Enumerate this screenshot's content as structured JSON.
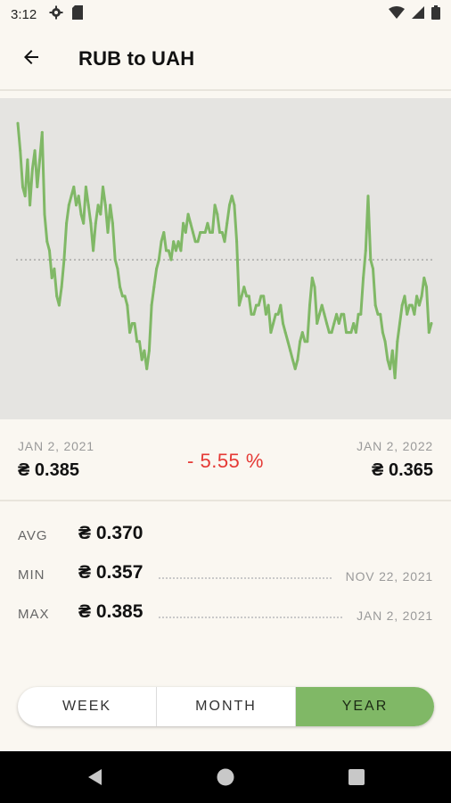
{
  "status_bar": {
    "time": "3:12"
  },
  "app_bar": {
    "title": "RUB to UAH"
  },
  "chart_data": {
    "type": "line",
    "title": "",
    "x_range": [
      "JAN 2, 2021",
      "JAN 2, 2022"
    ],
    "y_range": [
      0.355,
      0.386
    ],
    "reference_line": 0.37,
    "line_color": "#80b866",
    "grid": false,
    "values": [
      0.385,
      0.382,
      0.378,
      0.377,
      0.381,
      0.376,
      0.38,
      0.382,
      0.378,
      0.381,
      0.384,
      0.375,
      0.372,
      0.371,
      0.368,
      0.369,
      0.366,
      0.365,
      0.367,
      0.37,
      0.374,
      0.376,
      0.377,
      0.378,
      0.376,
      0.377,
      0.375,
      0.374,
      0.378,
      0.376,
      0.374,
      0.371,
      0.374,
      0.376,
      0.375,
      0.378,
      0.376,
      0.373,
      0.376,
      0.374,
      0.37,
      0.369,
      0.367,
      0.366,
      0.366,
      0.365,
      0.362,
      0.363,
      0.363,
      0.361,
      0.361,
      0.359,
      0.36,
      0.358,
      0.36,
      0.365,
      0.367,
      0.369,
      0.37,
      0.372,
      0.373,
      0.371,
      0.371,
      0.37,
      0.372,
      0.371,
      0.372,
      0.371,
      0.374,
      0.373,
      0.375,
      0.374,
      0.373,
      0.372,
      0.372,
      0.373,
      0.373,
      0.373,
      0.374,
      0.373,
      0.373,
      0.376,
      0.375,
      0.373,
      0.373,
      0.372,
      0.374,
      0.376,
      0.377,
      0.376,
      0.372,
      0.365,
      0.366,
      0.367,
      0.366,
      0.366,
      0.364,
      0.364,
      0.365,
      0.365,
      0.366,
      0.366,
      0.364,
      0.365,
      0.362,
      0.363,
      0.364,
      0.364,
      0.365,
      0.363,
      0.362,
      0.361,
      0.36,
      0.359,
      0.358,
      0.359,
      0.361,
      0.362,
      0.361,
      0.361,
      0.365,
      0.368,
      0.367,
      0.363,
      0.364,
      0.365,
      0.364,
      0.363,
      0.362,
      0.362,
      0.363,
      0.364,
      0.363,
      0.364,
      0.364,
      0.362,
      0.362,
      0.362,
      0.363,
      0.362,
      0.364,
      0.364,
      0.368,
      0.371,
      0.377,
      0.37,
      0.369,
      0.365,
      0.364,
      0.364,
      0.362,
      0.361,
      0.359,
      0.358,
      0.36,
      0.357,
      0.361,
      0.363,
      0.365,
      0.366,
      0.364,
      0.365,
      0.365,
      0.364,
      0.366,
      0.365,
      0.366,
      0.368,
      0.367,
      0.362,
      0.363
    ]
  },
  "summary": {
    "start_date": "JAN 2, 2021",
    "start_rate": "₴ 0.385",
    "change": "- 5.55 %",
    "end_date": "JAN 2, 2022",
    "end_rate": "₴ 0.365"
  },
  "stats": {
    "avg": {
      "label": "AVG",
      "value": "₴ 0.370"
    },
    "min": {
      "label": "MIN",
      "value": "₴ 0.357",
      "date": "NOV 22, 2021"
    },
    "max": {
      "label": "MAX",
      "value": "₴ 0.385",
      "date": "JAN 2, 2021"
    }
  },
  "period_selector": {
    "options": [
      "WEEK",
      "MONTH",
      "YEAR"
    ],
    "selected": "YEAR"
  },
  "colors": {
    "accent": "#80b866",
    "negative": "#e53935",
    "background": "#faf7f1"
  }
}
